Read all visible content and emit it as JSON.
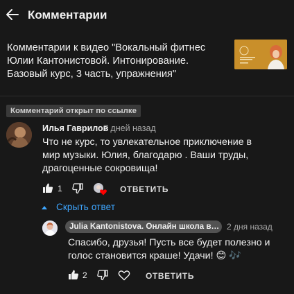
{
  "header": {
    "title": "Комментарии"
  },
  "video": {
    "title": "Комментарии к видео \"Вокальный фитнес Юлии Кантонистовой. Интонирование. Базовый курс, 3 часть, упражнения\""
  },
  "link_badge": "Комментарий открыт по ссылке",
  "comment": {
    "author": "Илья Гаврилов",
    "time": "7 дней назад",
    "text": "Что не курс, то увлекательное приключение в мир музыки. Юлия, благодарю . Ваши труды, драгоценные сокровища!",
    "likes": "1",
    "reply_label": "ОТВЕТИТЬ"
  },
  "hide_replies_label": "Скрыть ответ",
  "reply": {
    "author": "Julia Kantonistova. Онлайн школа вокала",
    "time": "2 дня назад",
    "text": "Спасибо, друзья! Пусть все будет полезно и голос становится краше! Удачи! 😊 🎶",
    "likes": "2",
    "reply_label": "ОТВЕТИТЬ"
  },
  "colors": {
    "background": "#181818",
    "link_blue": "#3ea6ff",
    "heart_red": "#ff0000",
    "badge_bg": "#3a3a3a"
  },
  "icons": [
    "back-arrow-icon",
    "thumbs-up-icon",
    "thumbs-down-icon",
    "heart-icon",
    "caret-up-icon"
  ]
}
